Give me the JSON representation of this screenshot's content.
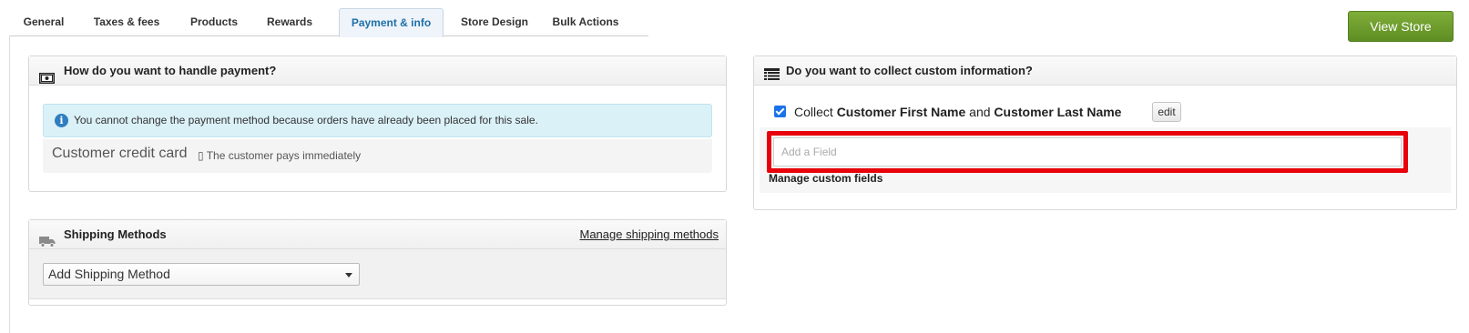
{
  "tabs": {
    "items": [
      {
        "label": "General"
      },
      {
        "label": "Taxes & fees"
      },
      {
        "label": "Products"
      },
      {
        "label": "Rewards"
      },
      {
        "label": "Payment & info"
      },
      {
        "label": "Store Design"
      },
      {
        "label": "Bulk Actions"
      }
    ],
    "active": "Payment & info"
  },
  "header": {
    "view_store_label": "View Store"
  },
  "payment": {
    "title": "How do you want to handle payment?",
    "alert": "You cannot change the payment method because orders have already been placed for this sale.",
    "method_name": "Customer credit card",
    "method_desc": "▯ The customer pays immediately"
  },
  "shipping": {
    "title": "Shipping Methods",
    "manage_link": "Manage shipping methods",
    "select_value": "Add Shipping Method"
  },
  "custom_info": {
    "title": "Do you want to collect custom information?",
    "collect_prefix": "Collect",
    "first_name": "Customer First Name",
    "and": "and",
    "last_name": "Customer Last Name",
    "checked": true,
    "edit_label": "edit",
    "add_field_placeholder": "Add a Field",
    "manage_fields": "Manage custom fields"
  },
  "colors": {
    "accent": "#1f6fa8",
    "view_store_bg": "#6a9c2c",
    "highlight": "#e8000b",
    "alert_bg": "#dbf1f8"
  }
}
